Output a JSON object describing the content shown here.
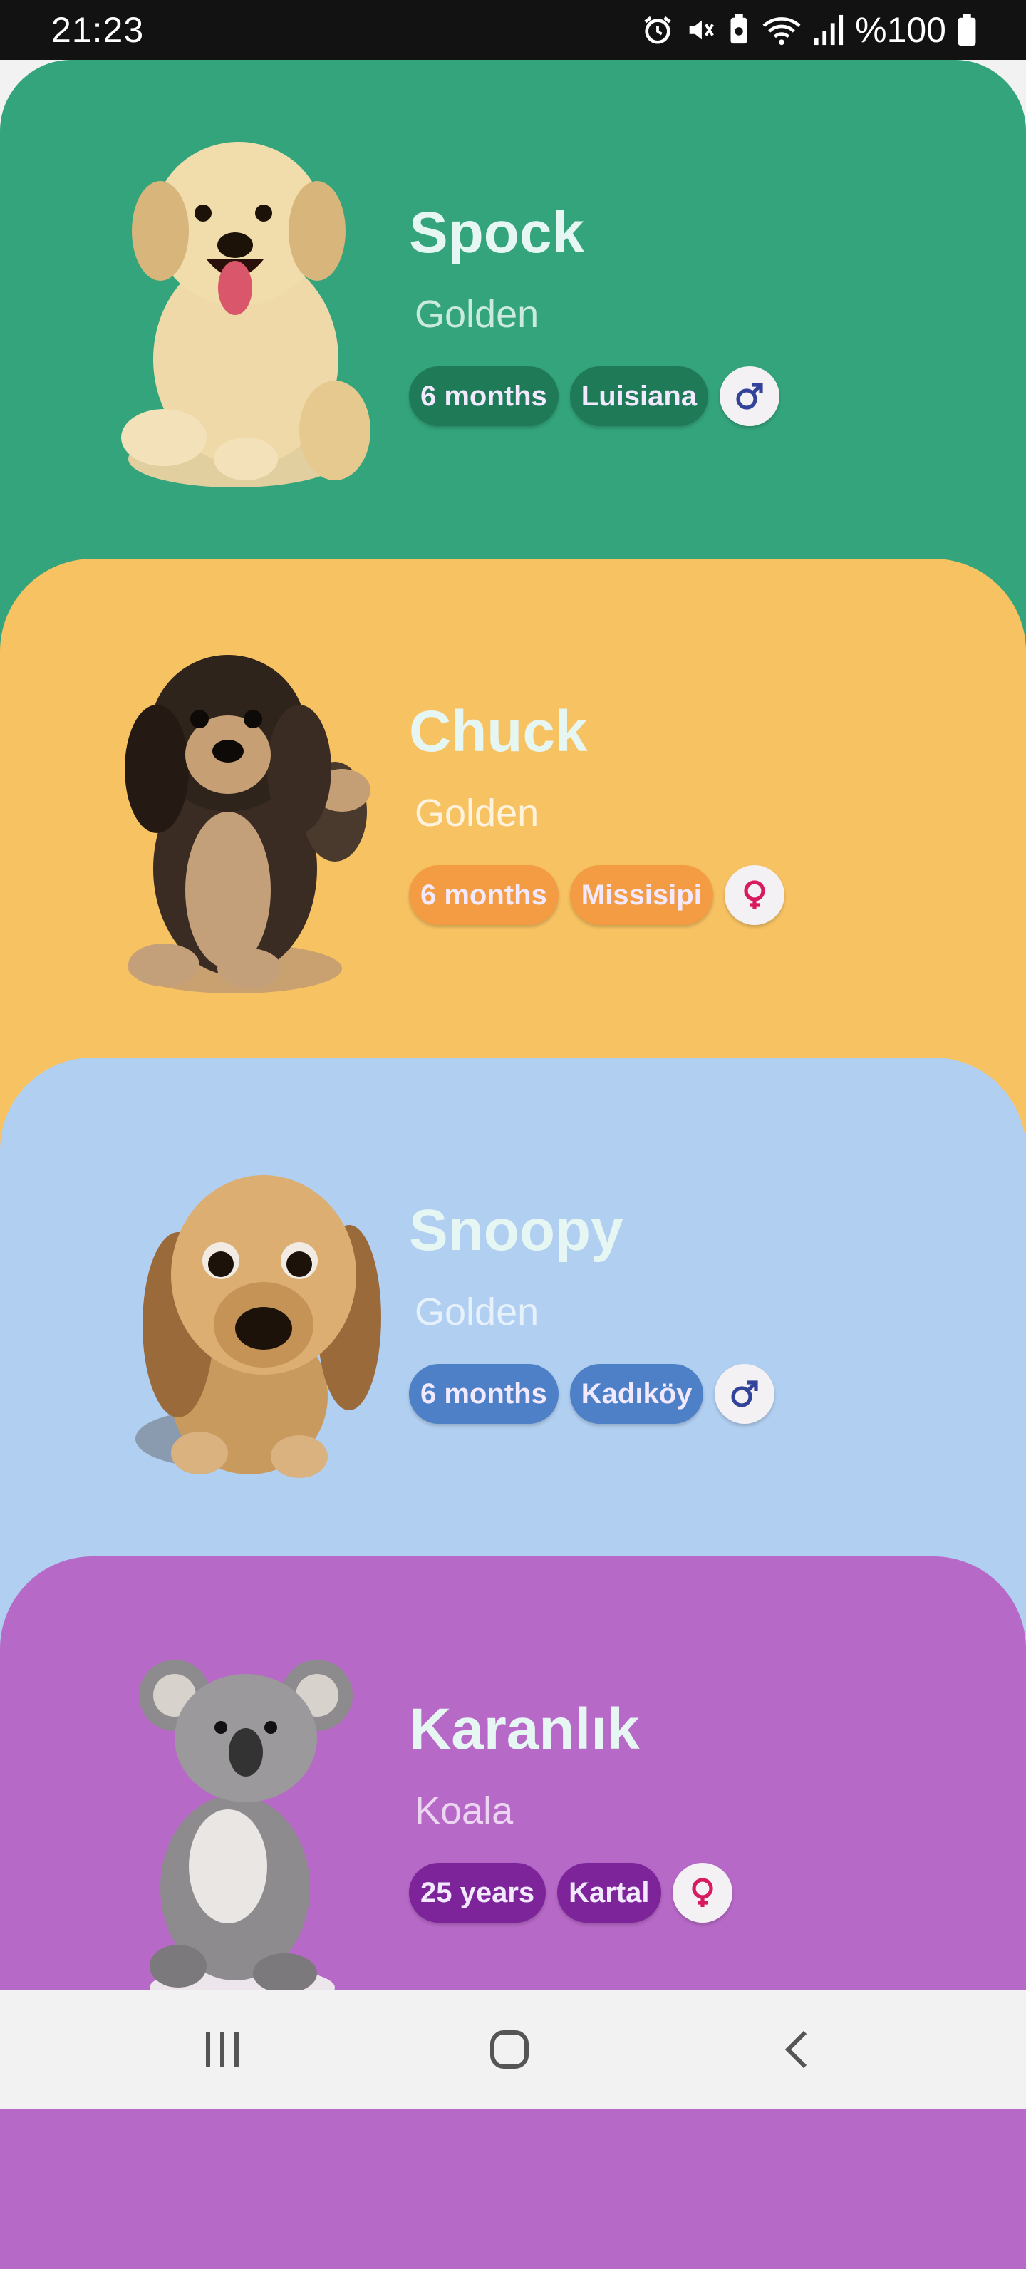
{
  "status_bar": {
    "time": "21:23",
    "battery": "%100",
    "icons": [
      "alarm-icon",
      "mute-icon",
      "battery-saver-icon",
      "wifi-icon",
      "signal-icon",
      "battery-icon"
    ]
  },
  "pets": [
    {
      "name": "Spock",
      "breed": "Golden",
      "age": "6 months",
      "location": "Luisiana",
      "gender": "male",
      "colors": {
        "card": "#33a47c",
        "chip": "#1f7a58",
        "breed_text": "#c9eadd",
        "gender_symbol": "#33439a"
      }
    },
    {
      "name": "Chuck",
      "breed": "Golden",
      "age": "6 months",
      "location": "Missisipi",
      "gender": "female",
      "colors": {
        "card": "#f7c262",
        "chip": "#f39c43",
        "breed_text": "#fff3de",
        "gender_symbol": "#d81b60"
      }
    },
    {
      "name": "Snoopy",
      "breed": "Golden",
      "age": "6 months",
      "location": "Kadıköy",
      "gender": "male",
      "colors": {
        "card": "#b1cff1",
        "chip": "#4d80c7",
        "breed_text": "#e6f1fb",
        "gender_symbol": "#33439a"
      }
    },
    {
      "name": "Karanlık",
      "breed": "Koala",
      "age": "25 years",
      "location": "Kartal",
      "gender": "female",
      "colors": {
        "card": "#b769c7",
        "chip": "#7d249a",
        "breed_text": "#ecd5f1",
        "gender_symbol": "#d81b60"
      }
    }
  ],
  "nav": {
    "buttons": [
      "recent-apps-icon",
      "home-icon",
      "back-icon"
    ]
  }
}
